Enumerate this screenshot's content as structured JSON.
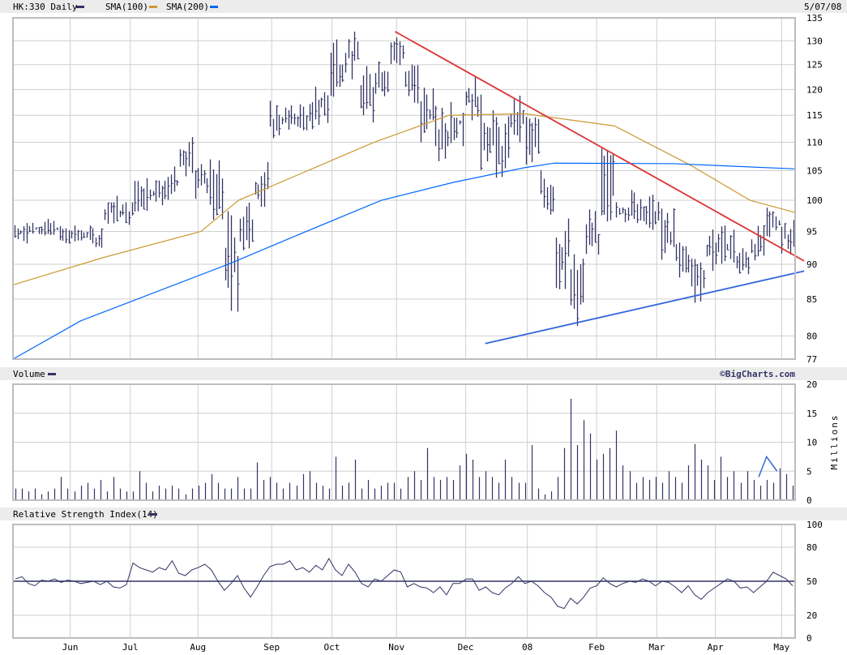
{
  "header": {
    "symbol_label": "HK:330 Daily",
    "sma100_label": "SMA(100)",
    "sma200_label": "SMA(200)",
    "date": "5/07/08",
    "price_swatch": "#333366",
    "sma100_color": "#cc9933",
    "sma200_color": "#0066ff"
  },
  "volume_panel": {
    "label": "Volume",
    "credit": "©BigCharts.com",
    "unit": "Millions"
  },
  "rsi_panel": {
    "label": "Relative Strength Index(14)"
  },
  "chart_data": [
    {
      "type": "bar",
      "title": "HK:330 Daily",
      "scale": "log",
      "ylim": [
        77,
        135
      ],
      "yticks": [
        "135",
        "130",
        "125",
        "120",
        "115",
        "110",
        "105",
        "100",
        "95",
        "90",
        "85",
        "80",
        "77"
      ],
      "xticks": [
        "Jun",
        "Jul",
        "Aug",
        "Sep",
        "Oct",
        "Nov",
        "Dec",
        "08",
        "Feb",
        "Mar",
        "Apr",
        "May"
      ],
      "xtick_weeks": [
        3.8,
        7.8,
        12.3,
        17.2,
        21.2,
        25.5,
        30.1,
        34.2,
        38.8,
        42.8,
        46.7,
        51.1
      ],
      "weeks": 52,
      "weekly_high": [
        97,
        97,
        97,
        96,
        96,
        96,
        101,
        100,
        105,
        104,
        106,
        111,
        107,
        107,
        99,
        100,
        107,
        118,
        117,
        118,
        121,
        133,
        132,
        125,
        128,
        132,
        126,
        122,
        117,
        120,
        123,
        119,
        115,
        119,
        116,
        106,
        98,
        92,
        100,
        109,
        101,
        102,
        101,
        99,
        94,
        92,
        97,
        96,
        93,
        96,
        99,
        98
      ],
      "weekly_low": [
        93,
        94,
        94,
        93,
        93,
        92,
        96,
        96,
        98,
        99,
        100,
        102,
        100,
        96,
        82,
        92,
        98,
        110,
        112,
        111,
        113,
        117,
        122,
        113,
        118,
        124,
        117,
        110,
        105,
        108,
        114,
        105,
        102,
        110,
        105,
        97,
        86,
        81,
        88,
        96,
        96,
        96,
        95,
        90,
        88,
        84,
        88,
        90,
        88,
        90,
        94,
        91
      ],
      "sma100": {
        "name": "SMA(100)",
        "points": [
          [
            0,
            87
          ],
          [
            6,
            91
          ],
          [
            12.5,
            95
          ],
          [
            15,
            100
          ],
          [
            24,
            110
          ],
          [
            29,
            115
          ],
          [
            34,
            115.3
          ],
          [
            40,
            113
          ],
          [
            45,
            106
          ],
          [
            49,
            100
          ],
          [
            52,
            98
          ]
        ]
      },
      "sma200": {
        "name": "SMA(200)",
        "points": [
          [
            0,
            77
          ],
          [
            4.5,
            82
          ],
          [
            14.3,
            90
          ],
          [
            19.5,
            95
          ],
          [
            24.5,
            100
          ],
          [
            29.3,
            103
          ],
          [
            34,
            105.5
          ],
          [
            36,
            106.3
          ],
          [
            44,
            106.2
          ],
          [
            52,
            105.3
          ]
        ]
      },
      "trendlines": [
        {
          "name": "downtrend",
          "color": "#dd3333",
          "from": [
            25.4,
            132
          ],
          "to": [
            52.6,
            90.5
          ]
        },
        {
          "name": "uptrend",
          "color": "#3366dd",
          "from": [
            31.4,
            79
          ],
          "to": [
            52.6,
            89
          ]
        }
      ]
    },
    {
      "type": "bar",
      "title": "Volume",
      "ylabel": "Millions",
      "ylim": [
        0,
        20
      ],
      "yticks": [
        "20",
        "15",
        "10",
        "5",
        "0"
      ],
      "values": [
        2,
        2,
        1.5,
        2,
        1,
        1.5,
        2,
        4,
        2,
        1.5,
        2.5,
        3,
        2,
        3.5,
        1.5,
        4,
        2,
        1.5,
        1.5,
        5,
        3,
        1.5,
        2.5,
        2,
        2.5,
        2,
        1,
        2,
        2.5,
        3,
        4.5,
        3,
        2,
        2,
        4,
        2,
        2,
        6.5,
        3.5,
        4,
        3,
        2,
        3,
        2.5,
        4.5,
        5,
        3,
        2.5,
        2,
        7.5,
        2.5,
        3,
        7,
        2,
        3.5,
        2,
        2.5,
        3,
        3,
        2,
        4,
        5,
        3.5,
        9,
        4,
        3.5,
        4,
        3.5,
        6,
        8,
        7,
        4,
        5,
        4,
        3,
        7,
        4,
        3,
        3,
        9.5,
        2,
        1,
        1.5,
        4,
        9,
        17.5,
        9.5,
        13.8,
        11.5,
        7,
        8,
        9,
        12,
        6,
        5,
        3,
        4,
        3.5,
        4,
        3,
        5,
        4,
        3,
        6,
        9.7,
        7,
        6,
        3.5,
        7.5,
        4,
        5,
        3,
        5,
        3.5,
        2.5,
        3.5,
        3,
        5.5,
        4.5,
        2.5
      ],
      "annotation": {
        "color": "#3366dd",
        "points": [
          [
            113.8,
            4
          ],
          [
            115,
            7.5
          ],
          [
            116.6,
            5
          ]
        ]
      }
    },
    {
      "type": "line",
      "title": "Relative Strength Index(14)",
      "ylim": [
        0,
        100
      ],
      "yticks": [
        "100",
        "80",
        "50",
        "20",
        "0"
      ],
      "reference": 50,
      "values": [
        52,
        54,
        48,
        46,
        51,
        50,
        52,
        49,
        51,
        50,
        48,
        49,
        50,
        47,
        50,
        45,
        44,
        47,
        66,
        62,
        60,
        58,
        62,
        60,
        68,
        57,
        55,
        60,
        62,
        65,
        60,
        50,
        42,
        48,
        55,
        44,
        36,
        45,
        55,
        63,
        65,
        65,
        68,
        60,
        62,
        58,
        64,
        60,
        70,
        60,
        55,
        65,
        58,
        48,
        45,
        52,
        50,
        55,
        60,
        58,
        45,
        48,
        45,
        44,
        40,
        45,
        38,
        48,
        48,
        52,
        52,
        42,
        45,
        40,
        38,
        44,
        48,
        54,
        48,
        50,
        46,
        40,
        36,
        28,
        26,
        35,
        30,
        36,
        44,
        46,
        53,
        48,
        45,
        48,
        50,
        49,
        52,
        50,
        46,
        50,
        49,
        45,
        40,
        46,
        38,
        34,
        40,
        44,
        48,
        52,
        50,
        44,
        45,
        40,
        45,
        50,
        58,
        55,
        52,
        46
      ]
    }
  ]
}
